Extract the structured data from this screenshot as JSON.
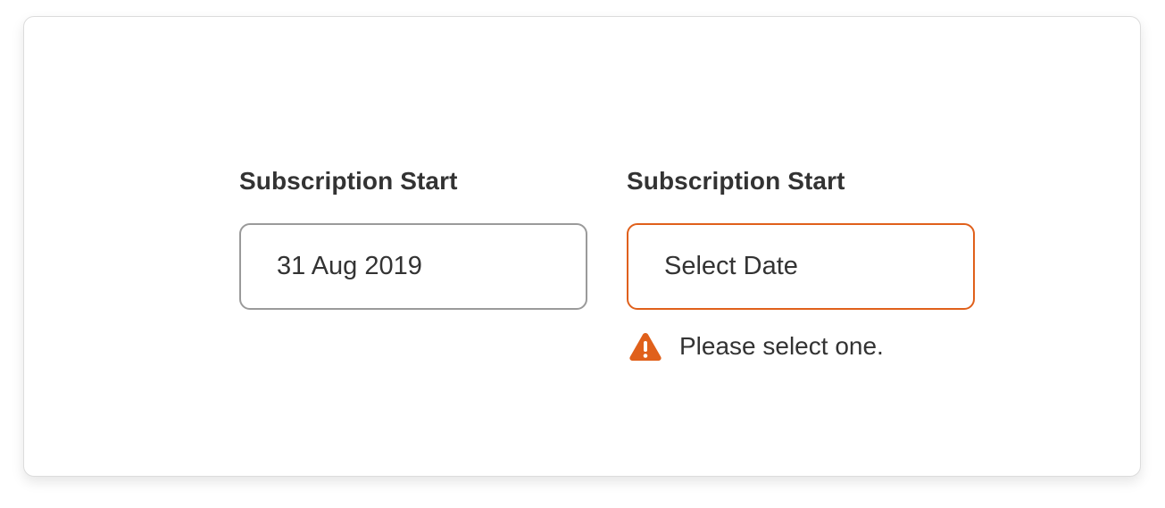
{
  "fields": [
    {
      "label": "Subscription Start",
      "value": "31 Aug 2019",
      "state": "filled"
    },
    {
      "label": "Subscription Start",
      "placeholder": "Select Date",
      "state": "error",
      "error_message": "Please select one.",
      "error_icon": "warning-triangle-icon"
    }
  ],
  "colors": {
    "error": "#e0601b",
    "border_default": "#9a9a9a",
    "text": "#333333"
  }
}
